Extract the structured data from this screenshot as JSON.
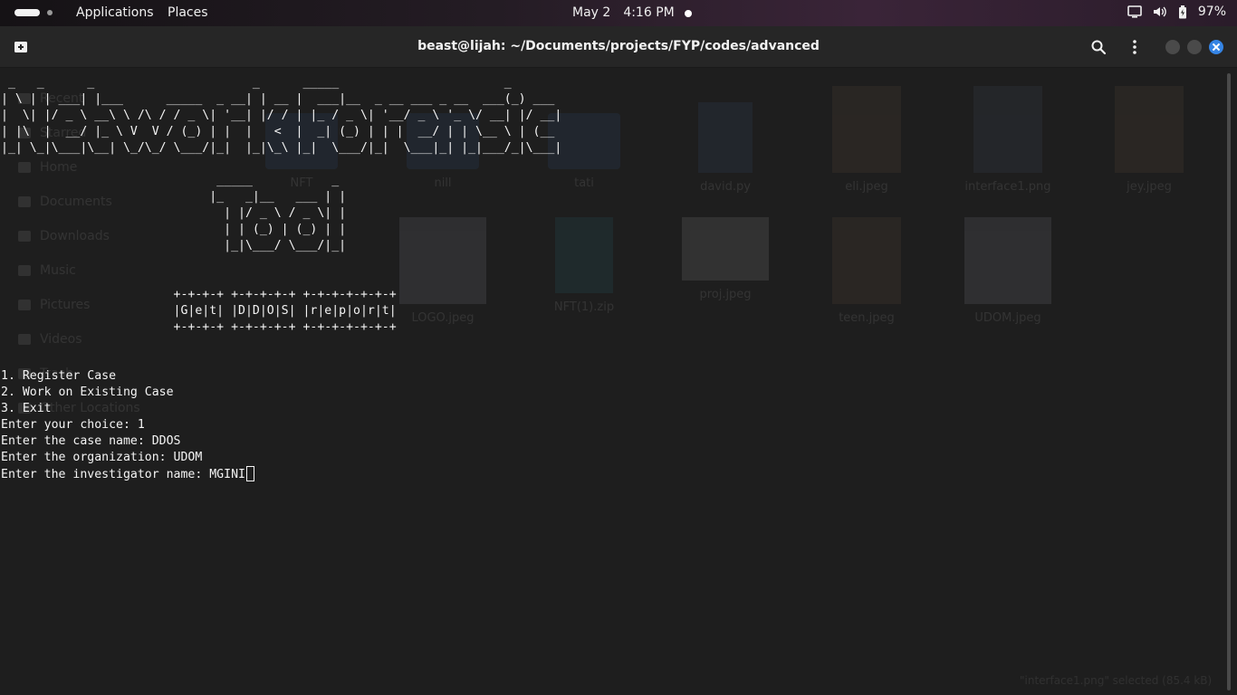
{
  "topbar": {
    "applications_label": "Applications",
    "places_label": "Places",
    "date": "May 2",
    "time": "4:16 PM",
    "battery_percent": "97%"
  },
  "window": {
    "title": "beast@lijah: ~/Documents/projects/FYP/codes/advanced"
  },
  "terminal": {
    "lines": [
      " _   _      _                      _      _____                       _          ",
      "| \\ | | ___| |___      _____  _ __| | __ |  ___|__  _ __ ___ _ __  ___(_) ___   ",
      "|  \\| |/ _ \\ __\\ \\ /\\ / / _ \\| '__| |/ / | |_ / _ \\| '__/ _ \\ '_ \\/ __| |/ __|  ",
      "| |\\  |  __/ |_ \\ V  V / (_) | |  |   <  |  _| (_) | | |  __/ | | \\__ \\ | (__   ",
      "|_| \\_|\\___|\\__| \\_/\\_/ \\___/|_|  |_|\\_\\ |_|  \\___/|_|  \\___|_| |_|___/_|\\___|  ",
      "",
      "                              _____           _ ",
      "                             |_   _|__   ___ | |",
      "                               | |/ _ \\ / _ \\| |",
      "                               | | (_) | (_) | |",
      "                               |_|\\___/ \\___/|_|",
      "",
      "",
      "                        +-+-+-+ +-+-+-+-+ +-+-+-+-+-+-+",
      "                        |G|e|t| |D|D|O|S| |r|e|p|o|r|t|",
      "                        +-+-+-+ +-+-+-+-+ +-+-+-+-+-+-+",
      "",
      "",
      "1. Register Case",
      "2. Work on Existing Case",
      "3. Exit",
      "Enter your choice: 1",
      "Enter the case name: DDOS",
      "Enter the organization: UDOM",
      "Enter the investigator name: MGINI"
    ]
  },
  "background_files": {
    "sidebar": [
      "Recent",
      "Starred",
      "Home",
      "Documents",
      "Downloads",
      "Music",
      "Pictures",
      "Videos",
      "Trash",
      "Other Locations"
    ],
    "row1": [
      "NFT",
      "nill",
      "tati",
      "david.py",
      "eli.jpeg",
      "interface1.png",
      "jey.jpeg"
    ],
    "row2": [
      "LOGO.jpeg",
      "NFT(1).zip",
      "proj.jpeg",
      "teen.jpeg",
      "UDOM.jpeg"
    ],
    "status": "\"interface1.png\" selected (85.4 kB)"
  }
}
